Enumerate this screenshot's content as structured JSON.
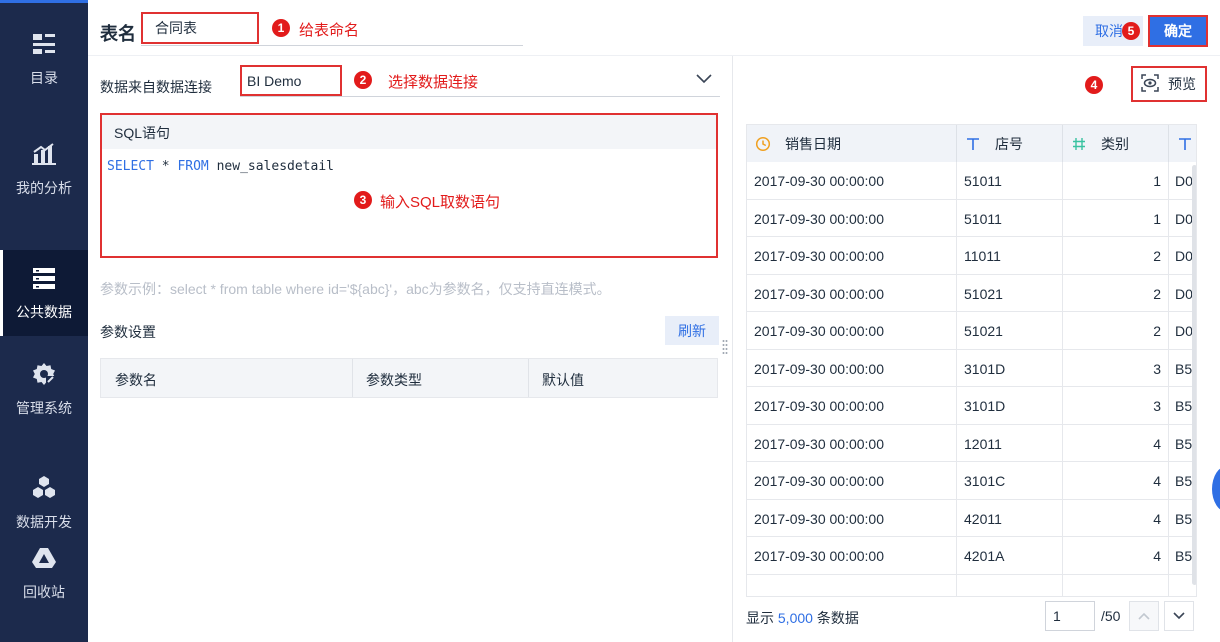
{
  "sidebar": {
    "items": [
      {
        "label": "目录",
        "icon": "catalog-icon"
      },
      {
        "label": "我的分析",
        "icon": "bar-chart-icon"
      },
      {
        "label": "公共数据",
        "icon": "database-icon",
        "active": true
      },
      {
        "label": "管理系统",
        "icon": "gear-icon"
      },
      {
        "label": "数据开发",
        "icon": "cube-icon"
      },
      {
        "label": "回收站",
        "icon": "recycle-icon"
      }
    ]
  },
  "header": {
    "title_label": "表名",
    "table_name": "合同表",
    "cancel_label": "取消",
    "confirm_label": "确定"
  },
  "annotations": {
    "step1": {
      "num": "1",
      "text": "给表命名"
    },
    "step2": {
      "num": "2",
      "text": "选择数据连接"
    },
    "step3": {
      "num": "3",
      "text": "输入SQL取数语句"
    },
    "step4": {
      "num": "4"
    },
    "step5": {
      "num": "5"
    }
  },
  "source": {
    "label": "数据来自数据连接",
    "value": "BI Demo"
  },
  "sql": {
    "header": "SQL语句",
    "kw1": "SELECT",
    "star": " * ",
    "kw2": "FROM",
    "table": " new_salesdetail"
  },
  "params": {
    "hint": "参数示例：select * from table where id='${abc}'，abc为参数名，仅支持直连模式。",
    "title": "参数设置",
    "refresh_label": "刷新",
    "columns": [
      "参数名",
      "参数类型",
      "默认值"
    ]
  },
  "preview": {
    "button_label": "预览",
    "columns": [
      {
        "name": "销售日期",
        "icon": "clock-icon"
      },
      {
        "name": "店号",
        "icon": "text-type-icon"
      },
      {
        "name": "类别",
        "icon": "number-type-icon"
      },
      {
        "name": "",
        "icon": "text-type-icon"
      }
    ],
    "rows": [
      [
        "2017-09-30 00:00:00",
        "51011",
        "1",
        "D0"
      ],
      [
        "2017-09-30 00:00:00",
        "51011",
        "1",
        "D0"
      ],
      [
        "2017-09-30 00:00:00",
        "11011",
        "2",
        "D0"
      ],
      [
        "2017-09-30 00:00:00",
        "51021",
        "2",
        "D0"
      ],
      [
        "2017-09-30 00:00:00",
        "51021",
        "2",
        "D0"
      ],
      [
        "2017-09-30 00:00:00",
        "3101D",
        "3",
        "B5"
      ],
      [
        "2017-09-30 00:00:00",
        "3101D",
        "3",
        "B5"
      ],
      [
        "2017-09-30 00:00:00",
        "12011",
        "4",
        "B5"
      ],
      [
        "2017-09-30 00:00:00",
        "3101C",
        "4",
        "B5"
      ],
      [
        "2017-09-30 00:00:00",
        "42011",
        "4",
        "B5"
      ],
      [
        "2017-09-30 00:00:00",
        "4201A",
        "4",
        "B5"
      ],
      [
        "",
        "",
        "",
        ""
      ]
    ]
  },
  "footer": {
    "prefix": "显示 ",
    "count": "5,000",
    "suffix": " 条数据",
    "page": "1",
    "total_pages": "/50"
  },
  "colors": {
    "sidebar_bg": "#1c2a4c",
    "accent": "#2f6fe4",
    "annotation_red": "#e21b1b"
  }
}
